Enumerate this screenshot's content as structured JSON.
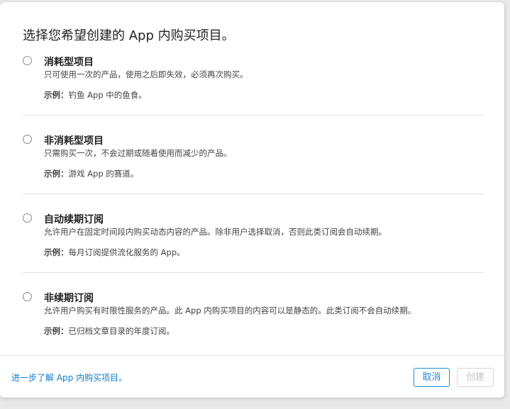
{
  "dialog": {
    "title": "选择您希望创建的 App 内购买项目。",
    "options": [
      {
        "title": "消耗型项目",
        "description": "只可使用一次的产品，使用之后即失效，必须再次购买。",
        "example_label": "示例：",
        "example_text": "钓鱼 App 中的鱼食。",
        "selected": false
      },
      {
        "title": "非消耗型项目",
        "description": "只需购买一次，不会过期或随着使用而减少的产品。",
        "example_label": "示例：",
        "example_text": "游戏 App 的赛道。",
        "selected": false
      },
      {
        "title": "自动续期订阅",
        "description": "允许用户在固定时间段内购买动态内容的产品。除非用户选择取消，否则此类订阅会自动续期。",
        "example_label": "示例：",
        "example_text": "每月订阅提供流化服务的 App。",
        "selected": false
      },
      {
        "title": "非续期订阅",
        "description": "允许用户购买有时限性服务的产品。此 App 内购买项目的内容可以是静态的。此类订阅不会自动续期。",
        "example_label": "示例：",
        "example_text": "已归档文章目录的年度订阅。",
        "selected": false
      }
    ],
    "footer": {
      "learn_more_link": "进一步了解 App 内购买项目。",
      "cancel_label": "取消",
      "create_label": "创建",
      "create_enabled": false
    }
  },
  "colors": {
    "link": "#0c7ed0",
    "primary_button": "#1d8ad6",
    "disabled_text": "#c4c4c4"
  }
}
